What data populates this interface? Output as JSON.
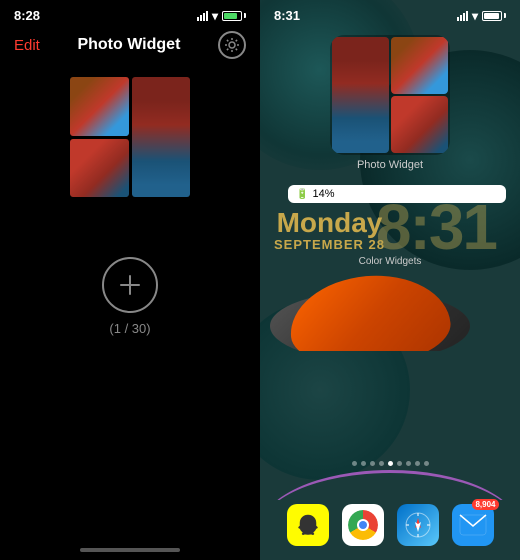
{
  "left": {
    "time": "8:28",
    "edit_label": "Edit",
    "title": "Photo Widget",
    "add_label": "(1 / 30)",
    "bottom_bar": true
  },
  "right": {
    "time": "8:31",
    "widget_label": "Photo Widget",
    "battery_percent": "14%",
    "day": "Monday",
    "date": "SEPTEMBER 28",
    "big_time": "8:31",
    "color_widgets_label": "Color Widgets",
    "dock": {
      "snapchat_label": "Snapchat",
      "chrome_label": "Chrome",
      "safari_label": "Safari",
      "mail_label": "Mail",
      "mail_badge": "8,904"
    }
  }
}
